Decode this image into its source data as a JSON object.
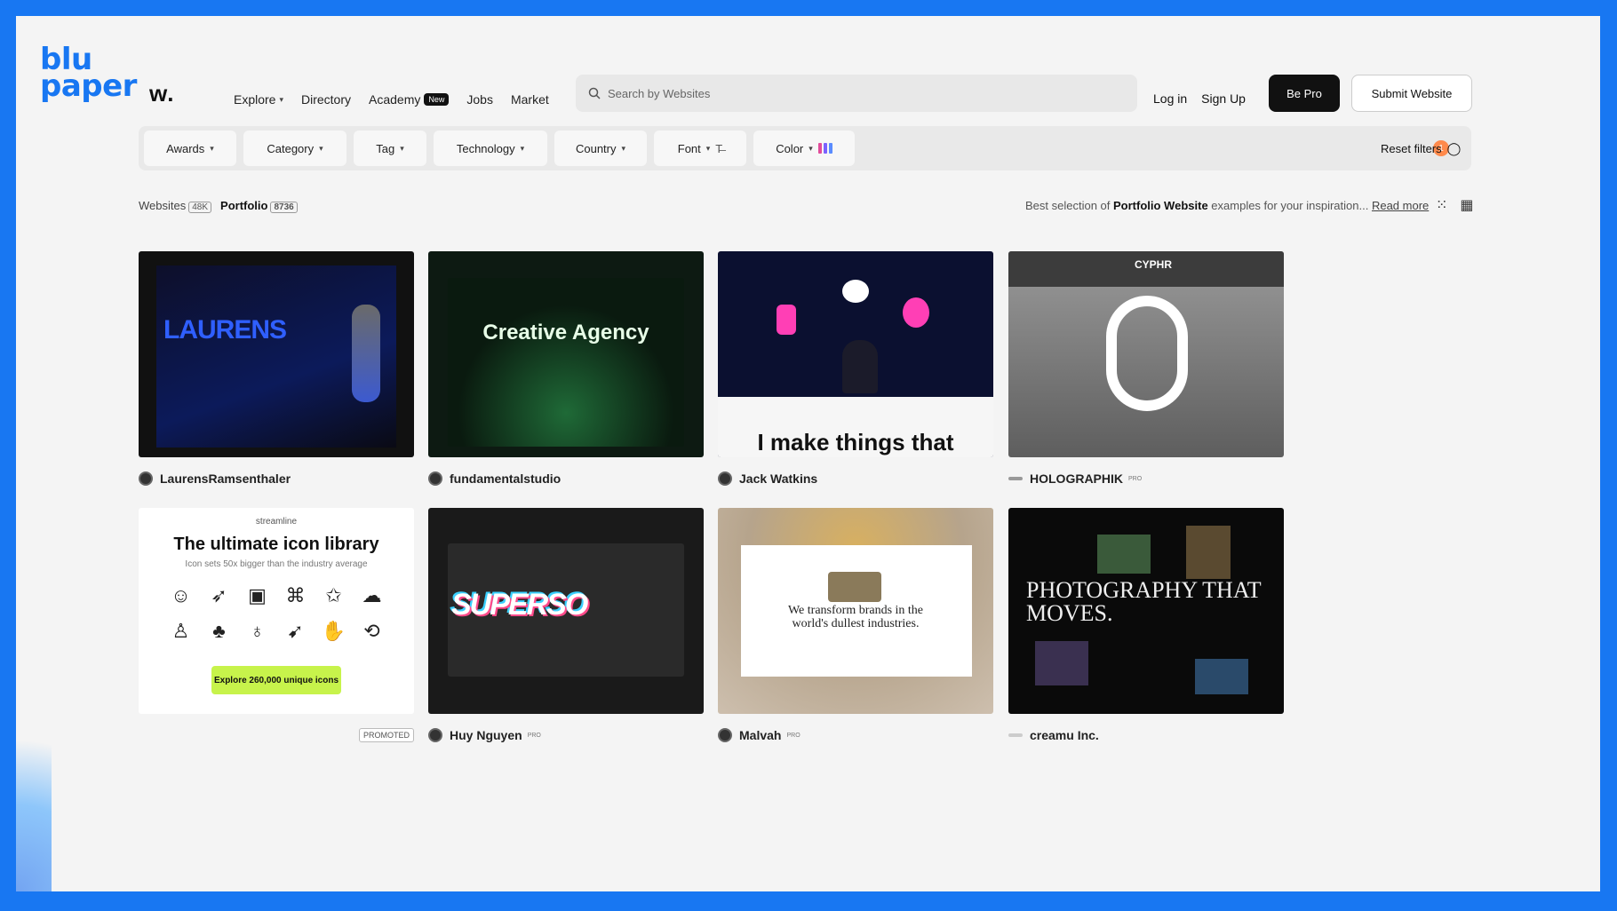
{
  "logo": {
    "line1": "blu",
    "line2": "paper"
  },
  "header": {
    "brand": "w.",
    "nav": [
      {
        "label": "Explore",
        "has_chevron": true
      },
      {
        "label": "Directory"
      },
      {
        "label": "Academy",
        "badge": "New"
      },
      {
        "label": "Jobs"
      },
      {
        "label": "Market"
      }
    ],
    "search_placeholder": "Search by Websites",
    "login": "Log in",
    "signup": "Sign Up",
    "be_pro": "Be Pro",
    "submit": "Submit Website"
  },
  "filters": {
    "items": [
      "Awards",
      "Category",
      "Tag",
      "Technology",
      "Country",
      "Font",
      "Color"
    ],
    "active_count": "1",
    "reset": "Reset filters",
    "color_swatches": [
      "#e24c9a",
      "#7b61ff",
      "#5a8cff"
    ]
  },
  "tabs": {
    "websites_label": "Websites",
    "websites_count": "48K",
    "portfolio_label": "Portfolio",
    "portfolio_count": "8736"
  },
  "description": {
    "prefix": "Best selection of",
    "bold": "Portfolio Website",
    "suffix": "examples for your inspiration...",
    "link": "Read more"
  },
  "cards": [
    {
      "author": "LaurensRamsenthaler",
      "title": "LAURENS",
      "pro": ""
    },
    {
      "author": "fundamentalstudio",
      "title": "Creative Agency",
      "pro": ""
    },
    {
      "author": "Jack Watkins",
      "title": "I make things that",
      "pro": ""
    },
    {
      "author": "HOLOGRAPHIK",
      "title": "CYPHR",
      "pro": "PRO"
    },
    {
      "author": "",
      "title": "The ultimate icon library",
      "subtitle": "Icon sets 50x bigger than the industry average",
      "brand": "streamline",
      "cta": "Explore 260,000 unique icons",
      "promoted": "PROMOTED"
    },
    {
      "author": "Huy Nguyen",
      "title": "SUPERSO",
      "pro": "PRO"
    },
    {
      "author": "Malvah",
      "title": "We transform brands in the world's dullest industries.",
      "pro": "PRO"
    },
    {
      "author": "creamu Inc.",
      "title": "PHOTOGRAPHY THAT MOVES.",
      "pro": ""
    }
  ]
}
